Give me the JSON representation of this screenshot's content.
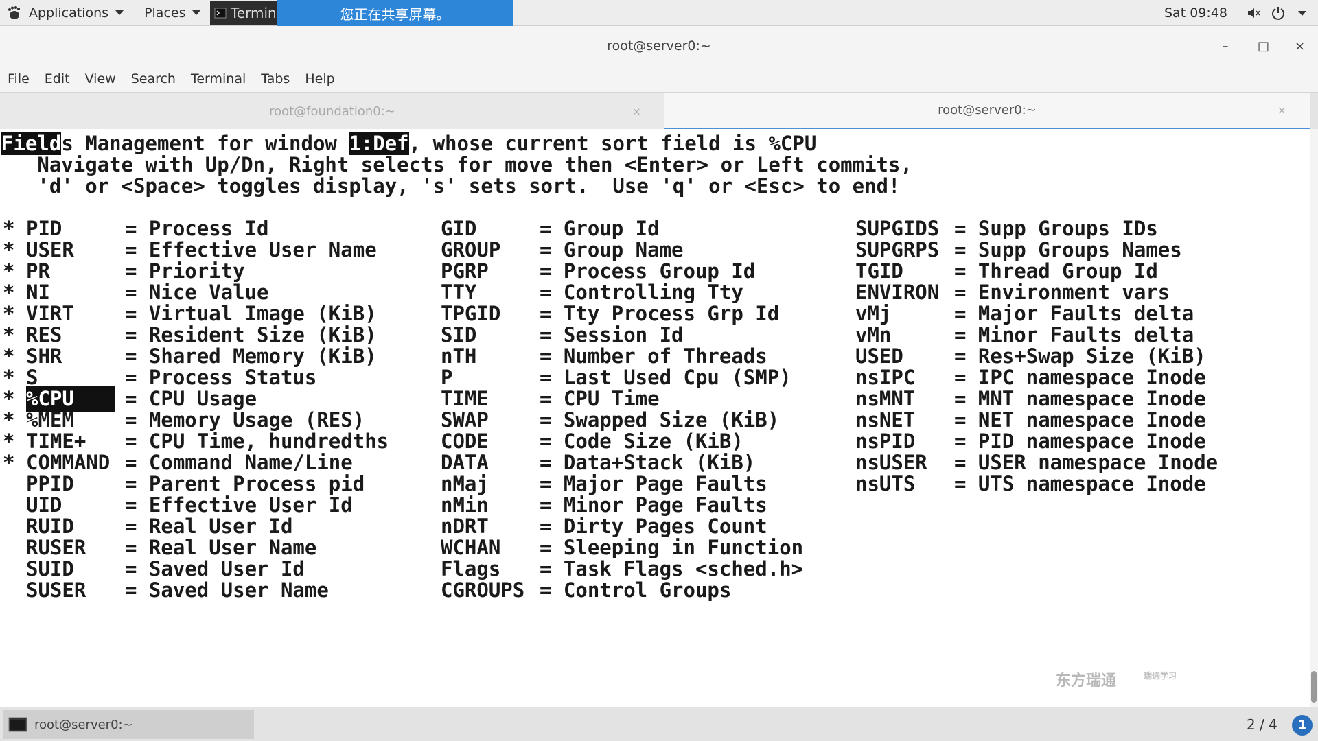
{
  "top_panel": {
    "applications_label": "Applications",
    "places_label": "Places",
    "task_label": "Termin",
    "share_banner": "您正在共享屏幕。",
    "clock": "Sat 09:48"
  },
  "window": {
    "title": "root@server0:~",
    "minimize": "–",
    "maximize": "□",
    "close": "×"
  },
  "menubar": {
    "items": [
      "File",
      "Edit",
      "View",
      "Search",
      "Terminal",
      "Tabs",
      "Help"
    ]
  },
  "tabs": [
    {
      "label": "root@foundation0:~",
      "close": "×"
    },
    {
      "label": "root@server0:~",
      "close": "×"
    }
  ],
  "terminal": {
    "header": {
      "fields_a": "Field",
      "fields_b": "s Management for window ",
      "window_tag": "1:Def",
      "rest": ", whose current sort field is %CPU"
    },
    "help_line_1": "   Navigate with Up/Dn, Right selects for move then <Enter> or Left commits,",
    "help_line_2": "   'd' or <Space> toggles display, 's' sets sort.  Use 'q' or <Esc> to end!",
    "column1": [
      {
        "mark": "*",
        "name": "PID    ",
        "desc": "= Process Id"
      },
      {
        "mark": "*",
        "name": "USER   ",
        "desc": "= Effective User Name"
      },
      {
        "mark": "*",
        "name": "PR     ",
        "desc": "= Priority"
      },
      {
        "mark": "*",
        "name": "NI     ",
        "desc": "= Nice Value"
      },
      {
        "mark": "*",
        "name": "VIRT   ",
        "desc": "= Virtual Image (KiB)"
      },
      {
        "mark": "*",
        "name": "RES    ",
        "desc": "= Resident Size (KiB)"
      },
      {
        "mark": "*",
        "name": "SHR    ",
        "desc": "= Shared Memory (KiB)"
      },
      {
        "mark": "*",
        "name": "S      ",
        "desc": "= Process Status"
      },
      {
        "mark": "*",
        "name": "%CPU   ",
        "desc": "= CPU Usage"
      },
      {
        "mark": "*",
        "name": "%MEM   ",
        "desc": "= Memory Usage (RES)"
      },
      {
        "mark": "*",
        "name": "TIME+  ",
        "desc": "= CPU Time, hundredths"
      },
      {
        "mark": "*",
        "name": "COMMAND",
        "desc": "= Command Name/Line"
      },
      {
        "mark": " ",
        "name": "PPID   ",
        "desc": "= Parent Process pid"
      },
      {
        "mark": " ",
        "name": "UID    ",
        "desc": "= Effective User Id"
      },
      {
        "mark": " ",
        "name": "RUID   ",
        "desc": "= Real User Id"
      },
      {
        "mark": " ",
        "name": "RUSER  ",
        "desc": "= Real User Name"
      },
      {
        "mark": " ",
        "name": "SUID   ",
        "desc": "= Saved User Id"
      },
      {
        "mark": " ",
        "name": "SUSER  ",
        "desc": "= Saved User Name"
      }
    ],
    "column2": [
      {
        "name": "GID    ",
        "desc": "= Group Id"
      },
      {
        "name": "GROUP  ",
        "desc": "= Group Name"
      },
      {
        "name": "PGRP   ",
        "desc": "= Process Group Id"
      },
      {
        "name": "TTY    ",
        "desc": "= Controlling Tty"
      },
      {
        "name": "TPGID  ",
        "desc": "= Tty Process Grp Id"
      },
      {
        "name": "SID    ",
        "desc": "= Session Id"
      },
      {
        "name": "nTH    ",
        "desc": "= Number of Threads"
      },
      {
        "name": "P      ",
        "desc": "= Last Used Cpu (SMP)"
      },
      {
        "name": "TIME   ",
        "desc": "= CPU Time"
      },
      {
        "name": "SWAP   ",
        "desc": "= Swapped Size (KiB)"
      },
      {
        "name": "CODE   ",
        "desc": "= Code Size (KiB)"
      },
      {
        "name": "DATA   ",
        "desc": "= Data+Stack (KiB)"
      },
      {
        "name": "nMaj   ",
        "desc": "= Major Page Faults"
      },
      {
        "name": "nMin   ",
        "desc": "= Minor Page Faults"
      },
      {
        "name": "nDRT   ",
        "desc": "= Dirty Pages Count"
      },
      {
        "name": "WCHAN  ",
        "desc": "= Sleeping in Function"
      },
      {
        "name": "Flags  ",
        "desc": "= Task Flags <sched.h>"
      },
      {
        "name": "CGROUPS",
        "desc": "= Control Groups"
      }
    ],
    "column3": [
      {
        "name": "SUPGIDS",
        "desc": "= Supp Groups IDs"
      },
      {
        "name": "SUPGRPS",
        "desc": "= Supp Groups Names"
      },
      {
        "name": "TGID   ",
        "desc": "= Thread Group Id"
      },
      {
        "name": "ENVIRON",
        "desc": "= Environment vars"
      },
      {
        "name": "vMj    ",
        "desc": "= Major Faults delta"
      },
      {
        "name": "vMn    ",
        "desc": "= Minor Faults delta"
      },
      {
        "name": "USED   ",
        "desc": "= Res+Swap Size (KiB)"
      },
      {
        "name": "nsIPC  ",
        "desc": "= IPC namespace Inode"
      },
      {
        "name": "nsMNT  ",
        "desc": "= MNT namespace Inode"
      },
      {
        "name": "nsNET  ",
        "desc": "= NET namespace Inode"
      },
      {
        "name": "nsPID  ",
        "desc": "= PID namespace Inode"
      },
      {
        "name": "nsUSER ",
        "desc": "= USER namespace Inode"
      },
      {
        "name": "nsUTS  ",
        "desc": "= UTS namespace Inode"
      }
    ],
    "watermark": "东方瑞通",
    "watermark_small": "瑞通学习"
  },
  "bottom_bar": {
    "task_label": "root@server0:~",
    "pager": "2 / 4",
    "notification_count": "1"
  }
}
